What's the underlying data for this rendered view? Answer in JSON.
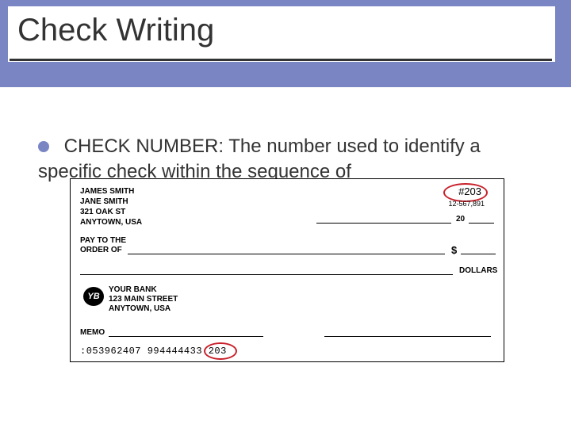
{
  "slide": {
    "title": "Check Writing",
    "bullet": "CHECK NUMBER:  The number used to identify a specific check within the sequence of"
  },
  "check": {
    "holder": {
      "name1": "JAMES SMITH",
      "name2": "JANE SMITH",
      "street": "321 OAK ST",
      "city": "ANYTOWN, USA"
    },
    "number_label": "#203",
    "routing_display": "12-567,891",
    "pay_to_label1": "PAY TO THE",
    "pay_to_label2": "ORDER OF",
    "currency_symbol": "$",
    "date_suffix": "20",
    "dollars_label": "DOLLARS",
    "bank": {
      "logo_text": "YB",
      "name": "YOUR BANK",
      "street": "123 MAIN STREET",
      "city": "ANYTOWN, USA"
    },
    "memo_label": "MEMO",
    "micr": ":053962407   994444433  203"
  }
}
